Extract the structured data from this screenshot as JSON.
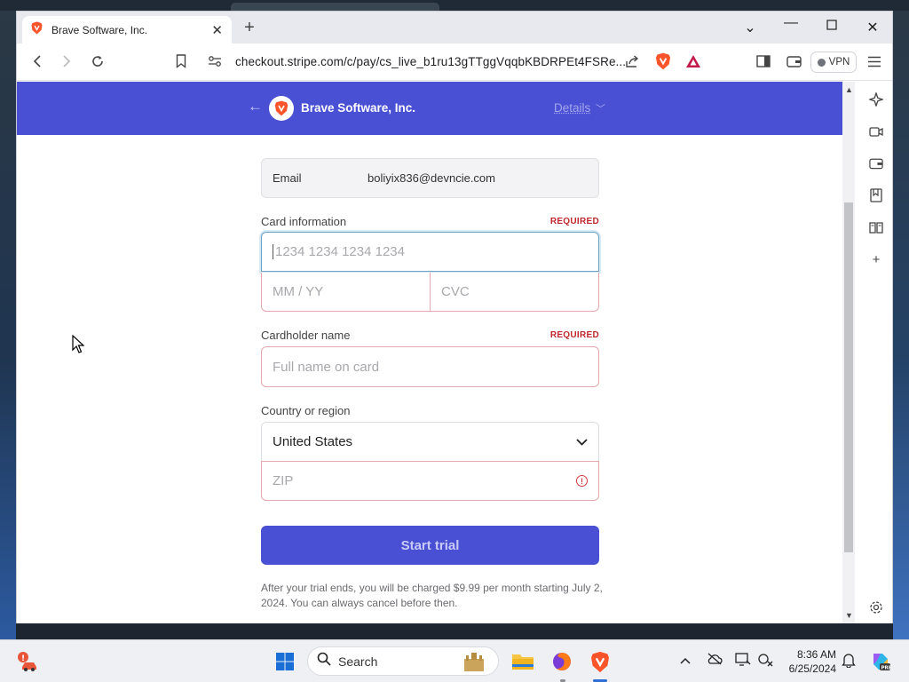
{
  "browser": {
    "tab_title": "Brave Software, Inc.",
    "url": "checkout.stripe.com/c/pay/cs_live_b1ru13gTTggVqqbKBDRPEt4FSRe...",
    "vpn_label": "VPN"
  },
  "header": {
    "company": "Brave Software, Inc.",
    "details_label": "Details"
  },
  "form": {
    "email_label": "Email",
    "email_value": "boliyix836@devncie.com",
    "card_label": "Card information",
    "required": "REQUIRED",
    "card_placeholder": "1234 1234 1234 1234",
    "exp_placeholder": "MM / YY",
    "cvc_placeholder": "CVC",
    "name_label": "Cardholder name",
    "name_placeholder": "Full name on card",
    "country_label": "Country or region",
    "country_value": "United States",
    "zip_placeholder": "ZIP",
    "submit_label": "Start trial",
    "disclaimer": "After your trial ends, you will be charged $9.99 per month starting July 2, 2024. You can always cancel before then."
  },
  "taskbar": {
    "search_label": "Search",
    "time": "8:36 AM",
    "date": "6/25/2024"
  },
  "colors": {
    "brand_accent": "#4a50d4",
    "required_red": "#c0262d",
    "brave_orange": "#fb542b"
  }
}
